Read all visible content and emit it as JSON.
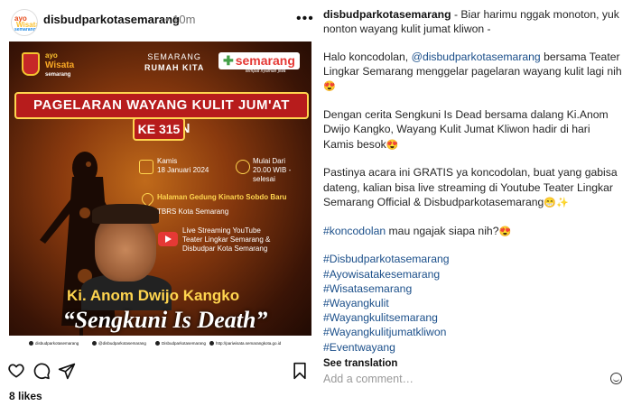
{
  "post": {
    "username": "disbudparkotasemarang",
    "time": "• 10m",
    "likes": "8 likes"
  },
  "poster": {
    "brand_top": "SEMARANG",
    "brand_sub": "RUMAH KITA",
    "logo_wisata_1": "ayo",
    "logo_wisata_2": "Wisata",
    "logo_wisata_3": "semarang",
    "logo_right": "semarang",
    "logo_right_sub": "tempat nyaman jiwa",
    "banner": "PAGELARAN WAYANG KULIT JUM'AT KLIWON",
    "ke": "KE 315",
    "day": "Kamis",
    "date": "18 Januari 2024",
    "start_label": "Mulai Dari",
    "start_time": "20.00 WIB -",
    "end": "selesai",
    "location": "Halaman Gedung Kinarto Sobdo Baru",
    "location_sub": "TBRS Kota Semarang",
    "stream_1": "Live Streaming YouTube",
    "stream_2": "Teater Lingkar Semarang &",
    "stream_3": "Disbudpar Kota Semarang",
    "dalang": "Ki. Anom Dwijo Kangko",
    "title": "“Sengkuni Is Death”",
    "footer": [
      "disbudparkotasemarang",
      "@disbudparkotasemarang",
      "Disbudparkotasemarang",
      "http://pariwisata.semarangkota.go.id"
    ]
  },
  "caption": {
    "username": "disbudparkotasemarang",
    "line1_text": " - Biar harimu nggak monoton, yuk nonton wayang kulit jumat kliwon -",
    "p2_a": "Halo koncodolan, ",
    "p2_link": "@disbudparkotasemarang",
    "p2_b": " bersama Teater Lingkar Semarang menggelar pagelaran wayang kulit lagi nih ",
    "p3": "Dengan cerita Sengkuni Is Dead bersama dalang Ki.Anom Dwijo Kangko, Wayang Kulit Jumat Kliwon hadir di hari Kamis besok",
    "p4": "Pastinya acara ini GRATIS ya koncodolan, buat yang gabisa dateng, kalian bisa live streaming di Youtube Teater Lingkar Semarang Official & Disbudparkotasemarang",
    "p5_link": "#koncodolan",
    "p5": " mau ngajak siapa nih?",
    "hashtags": [
      "#Disbudparkotasemarang",
      "#Ayowisatakesemarang",
      "#Wisatasemarang",
      "#Wayangkulit",
      "#Wayangkulitsemarang",
      "#Wayangkulitjumatkliwon",
      "#Eventwayang"
    ],
    "emoji_heart_eyes": "😍",
    "emoji_grin_sparkle": "😁✨"
  },
  "ui": {
    "see_translation": "See translation",
    "comment_placeholder": "Add a comment…",
    "more_dots": "•••"
  }
}
